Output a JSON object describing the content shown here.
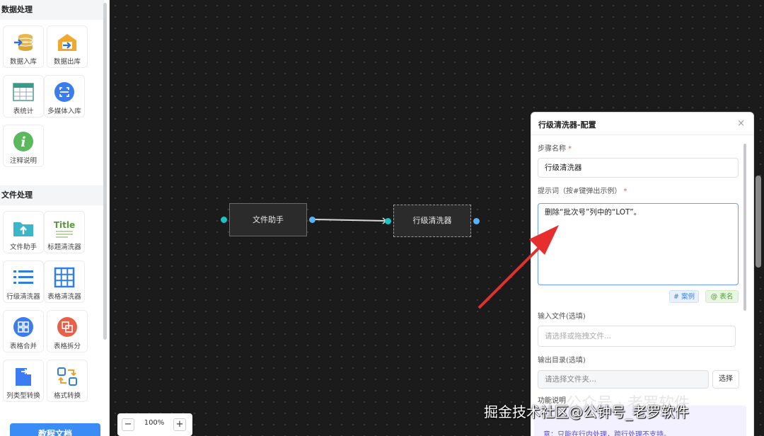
{
  "sidebar": {
    "sections": [
      {
        "title": "数据处理",
        "tools": [
          {
            "label": "数据入库",
            "icon": "database-import-icon"
          },
          {
            "label": "数据出库",
            "icon": "warehouse-export-icon"
          },
          {
            "label": "表统计",
            "icon": "table-grid-icon"
          },
          {
            "label": "多媒体入库",
            "icon": "multimedia-scan-icon"
          },
          {
            "label": "注释说明",
            "icon": "info-circle-icon"
          }
        ]
      },
      {
        "title": "文件处理",
        "tools": [
          {
            "label": "文件助手",
            "icon": "folder-upload-icon"
          },
          {
            "label": "标题清洗器",
            "icon": "title-text-icon"
          },
          {
            "label": "行级清洗器",
            "icon": "row-list-icon"
          },
          {
            "label": "表格清洗器",
            "icon": "table-clean-icon"
          },
          {
            "label": "表格合并",
            "icon": "table-merge-icon"
          },
          {
            "label": "表格拆分",
            "icon": "table-split-icon"
          },
          {
            "label": "列类型转换",
            "icon": "column-convert-icon"
          },
          {
            "label": "格式转换",
            "icon": "format-convert-icon"
          }
        ]
      }
    ],
    "tutorial_button": "教程文档"
  },
  "canvas": {
    "nodes": [
      {
        "label": "文件助手"
      },
      {
        "label": "行级清洗器"
      }
    ],
    "zoom": {
      "minus": "−",
      "level": "100%",
      "plus": "+"
    }
  },
  "panel": {
    "title": "行级清洗器-配置",
    "close_icon": "×",
    "step_name_label": "步骤名称",
    "step_name_value": "行级清洗器",
    "prompt_label": "提示词（按#键弹出示例）",
    "prompt_value": "删除“批次号”列中的“LOT”。",
    "example_button": "# 案例",
    "alias_button": "@ 表名",
    "input_file_label": "输入文件(选填)",
    "input_file_placeholder": "请选择或拖拽文件...",
    "output_dir_label": "输出目录(选填)",
    "output_dir_placeholder": "请选择文件夹...",
    "choose_button": "选择",
    "func_label": "功能说明",
    "func_text": "意：只能在行内处理，跨行处理不支持。"
  },
  "overlay": {
    "watermark_faint": "公众号 · 老罗软件",
    "watermark_main": "掘金技术社区@公钟号_老罗软件"
  },
  "colors": {
    "accent": "#3b8cf5",
    "port_teal": "#1ec4c4",
    "port_blue": "#5ab2f5",
    "arrow_red": "#e62e2e"
  }
}
